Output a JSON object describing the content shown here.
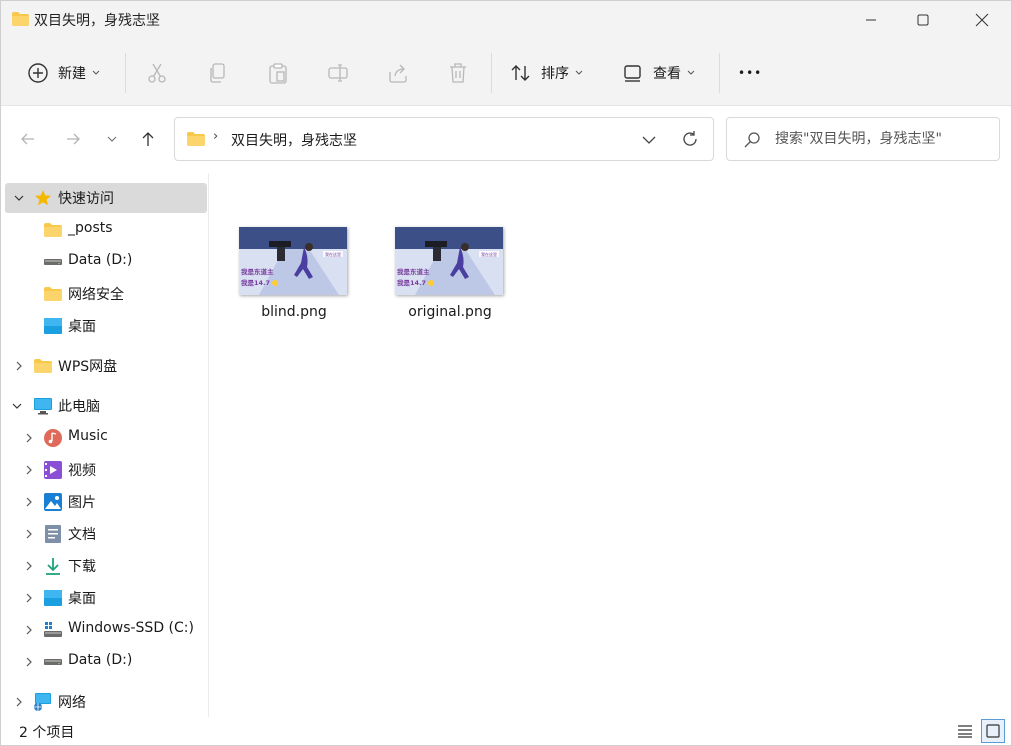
{
  "window": {
    "title": "双目失明，身残志坚"
  },
  "toolbar": {
    "new_label": "新建",
    "sort_label": "排序",
    "view_label": "查看",
    "more_label": "•••"
  },
  "address": {
    "separator": "›",
    "path": "双目失明，身残志坚"
  },
  "search": {
    "placeholder": "搜索\"双目失明，身残志坚\""
  },
  "sidebar": {
    "quick_access": "快速访问",
    "quick_items": [
      {
        "label": "_posts",
        "icon": "folder-icon"
      },
      {
        "label": "Data (D:)",
        "icon": "drive-icon"
      },
      {
        "label": "网络安全",
        "icon": "folder-icon"
      },
      {
        "label": "桌面",
        "icon": "desktop-icon"
      }
    ],
    "wps": "WPS网盘",
    "this_pc": "此电脑",
    "pc_items": [
      {
        "label": "Music",
        "icon": "music-icon"
      },
      {
        "label": "视频",
        "icon": "video-icon"
      },
      {
        "label": "图片",
        "icon": "pictures-icon"
      },
      {
        "label": "文档",
        "icon": "documents-icon"
      },
      {
        "label": "下载",
        "icon": "downloads-icon"
      },
      {
        "label": "桌面",
        "icon": "desktop-icon"
      },
      {
        "label": "Windows-SSD (C:)",
        "icon": "windows-drive-icon"
      },
      {
        "label": "Data (D:)",
        "icon": "drive-icon"
      }
    ],
    "network": "网络"
  },
  "files": [
    {
      "name": "blind.png",
      "thumb_caption_1": "我是东道主",
      "thumb_caption_2": "我是14.7"
    },
    {
      "name": "original.png",
      "thumb_caption_1": "我是东道主",
      "thumb_caption_2": "我是14.7"
    }
  ],
  "status": {
    "item_count": "2 个项目"
  },
  "colors": {
    "folder": "#f8c84a",
    "accent": "#0067c0",
    "selected_bg": "#dadada"
  }
}
